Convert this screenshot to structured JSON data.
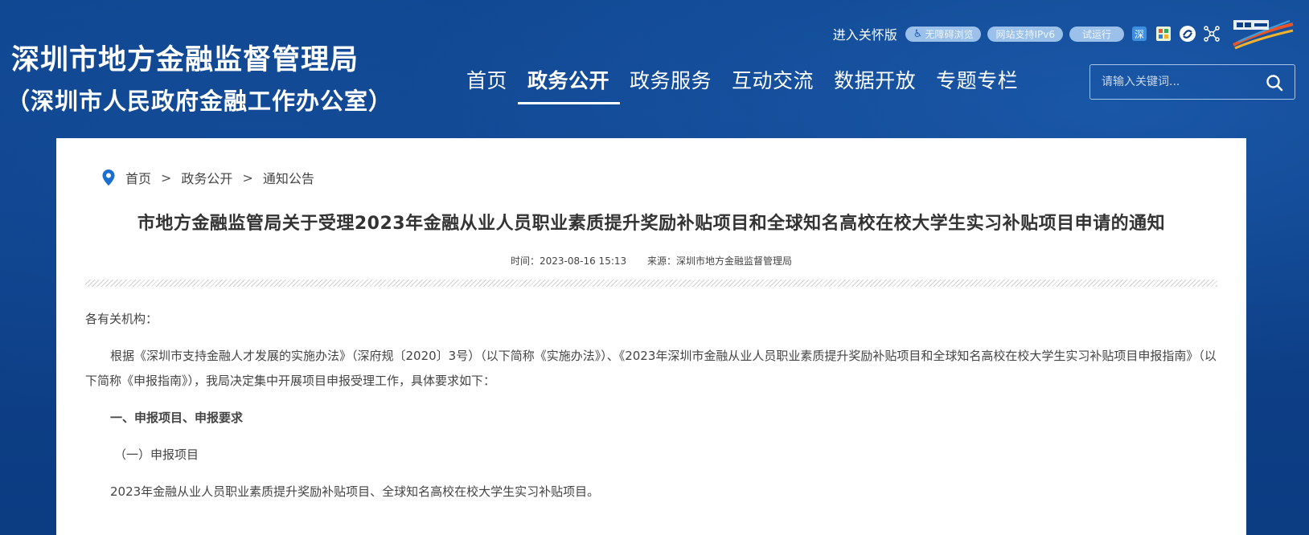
{
  "site": {
    "title": "深圳市地方金融监督管理局",
    "subtitle": "（深圳市人民政府金融工作办公室）"
  },
  "topbar": {
    "care_link": "进入关怀版",
    "accessible_label": "无障碍浏览",
    "ipv6_label": "网站支持IPv6",
    "trial_label": "试运行",
    "icons": [
      "accessibility-icon",
      "weibo-icon",
      "wechat-icon",
      "mini-app-icon",
      "network-icon",
      "shenzhen-logo"
    ]
  },
  "nav": {
    "items": [
      {
        "label": "首页"
      },
      {
        "label": "政务公开",
        "active": true
      },
      {
        "label": "政务服务"
      },
      {
        "label": "互动交流"
      },
      {
        "label": "数据开放"
      },
      {
        "label": "专题专栏"
      }
    ]
  },
  "search": {
    "placeholder": "请输入关键词..."
  },
  "breadcrumb": {
    "items": [
      "首页",
      "政务公开",
      "通知公告"
    ],
    "separator": ">"
  },
  "article": {
    "title": "市地方金融监管局关于受理2023年金融从业人员职业素质提升奖励补贴项目和全球知名高校在校大学生实习补贴项目申请的通知",
    "time": "时间：2023-08-16 15:13",
    "source": "来源：深圳市地方金融监督管理局",
    "greeting": "各有关机构：",
    "para1": "根据《深圳市支持金融人才发展的实施办法》（深府规〔2020〕3号）（以下简称《实施办法》）、《2023年深圳市金融从业人员职业素质提升奖励补贴项目和全球知名高校在校大学生实习补贴项目申报指南》（以下简称《申报指南》），我局决定集中开展项目申报受理工作，具体要求如下：",
    "heading1": "一、申报项目、申报要求",
    "heading2": "（一）申报项目",
    "para2": "2023年金融从业人员职业素质提升奖励补贴项目、全球知名高校在校大学生实习补贴项目。"
  },
  "colors": {
    "header_bg": "#0d3f86",
    "pill_bg": "#9bc1ea",
    "card_bg": "#ffffff",
    "accent_blue": "#1b6fd1"
  }
}
